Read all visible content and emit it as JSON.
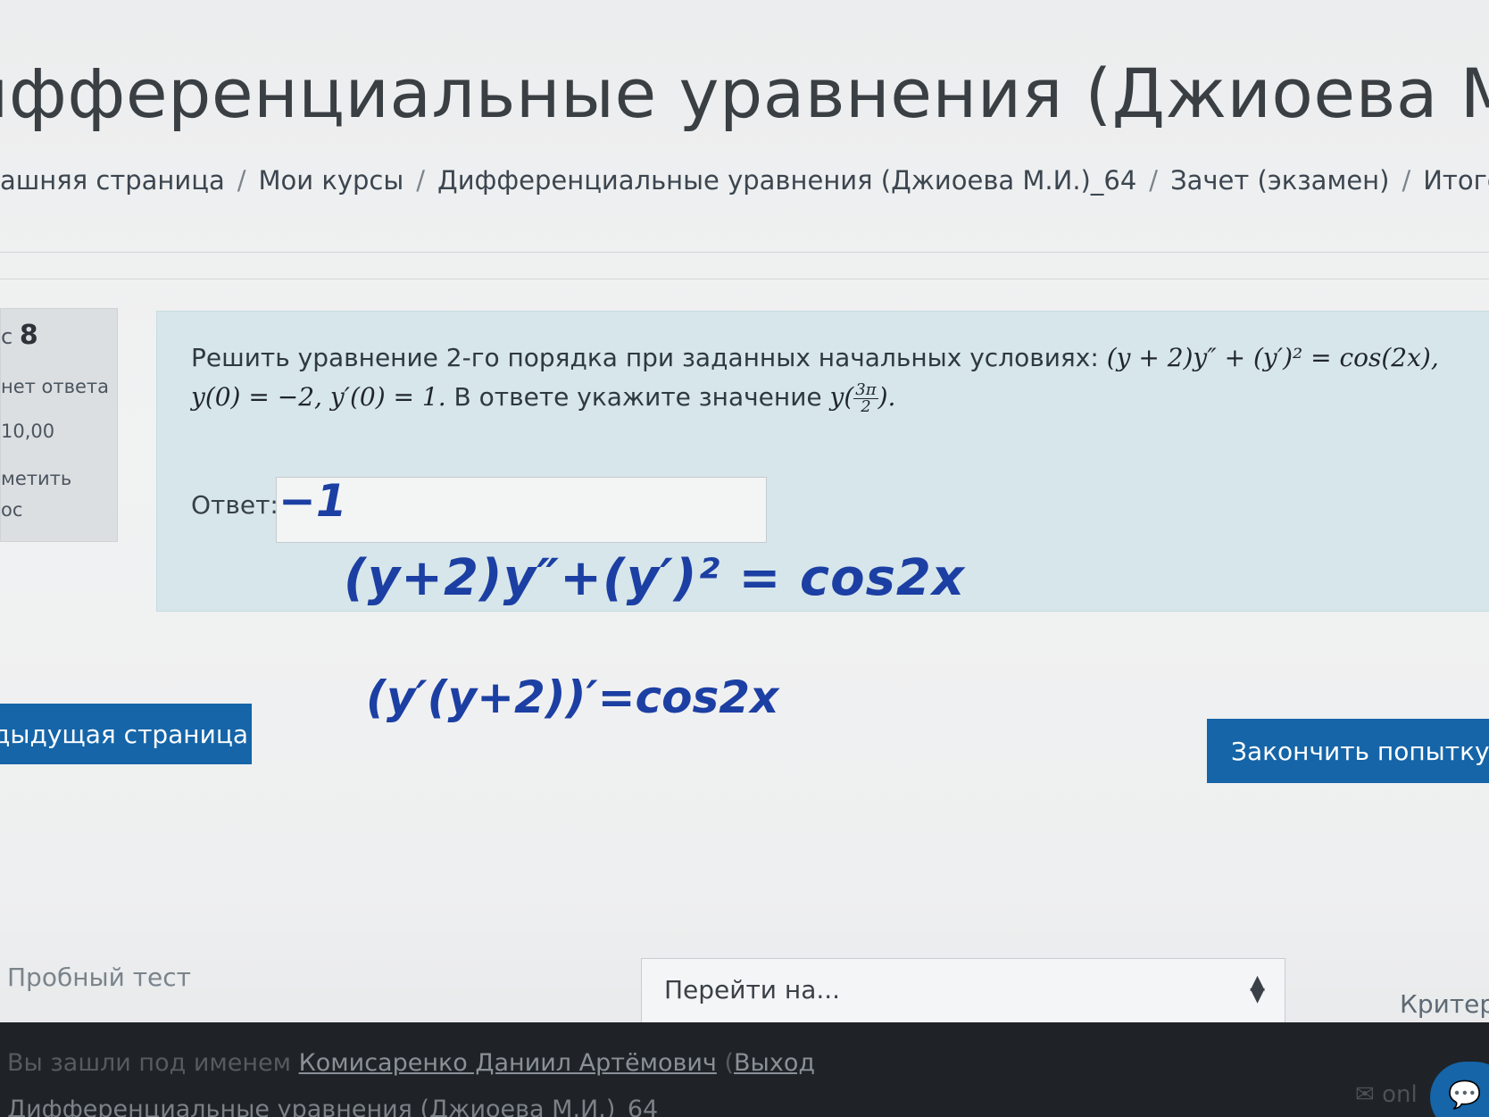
{
  "header": {
    "course_title": "ифференциальные уравнения (Джиоева М.И.)"
  },
  "breadcrumb": [
    "ашняя страница",
    "Мои курсы",
    "Дифференциальные уравнения (Джиоева М.И.)_64",
    "Зачет (экзамен)",
    "Итоговый тес"
  ],
  "question_info": {
    "number_prefix": "с",
    "number": "8",
    "state": "нет ответа",
    "mark": "10,00",
    "flag_line1": "метить",
    "flag_line2": "ос"
  },
  "question": {
    "text_part1": "Решить уравнение 2-го порядка при заданных начальных условиях: ",
    "equation": "(y + 2)y″ + (y′)² = cos(2x),",
    "initial_conditions": "y(0) = −2, y′(0) = 1.",
    "text_part2": " В ответе укажите значение ",
    "target_prefix": "y(",
    "target_num": "3π",
    "target_den": "2",
    "target_suffix": ").",
    "answer_label": "Ответ:"
  },
  "handwriting": {
    "answer": "−1",
    "line1": "(y+2)y″+(y′)² = cos2x",
    "line2": "(y′(y+2))′=cos2x"
  },
  "navigation": {
    "prev_page_button": "дыдущая страница",
    "finish_button": "Закончить попытку...",
    "prev_activity": "Пробный тест",
    "jump_to": "Перейти на...",
    "next_activity": "Критер"
  },
  "footer": {
    "logged_in_prefix": "Вы зашли под именем ",
    "user_name": "Комисаренко Даниил Артёмович",
    "logout": "Выход",
    "course_link": "Дифференциальные уравнения (Джиоева М.И.)_64",
    "online": "onl"
  }
}
